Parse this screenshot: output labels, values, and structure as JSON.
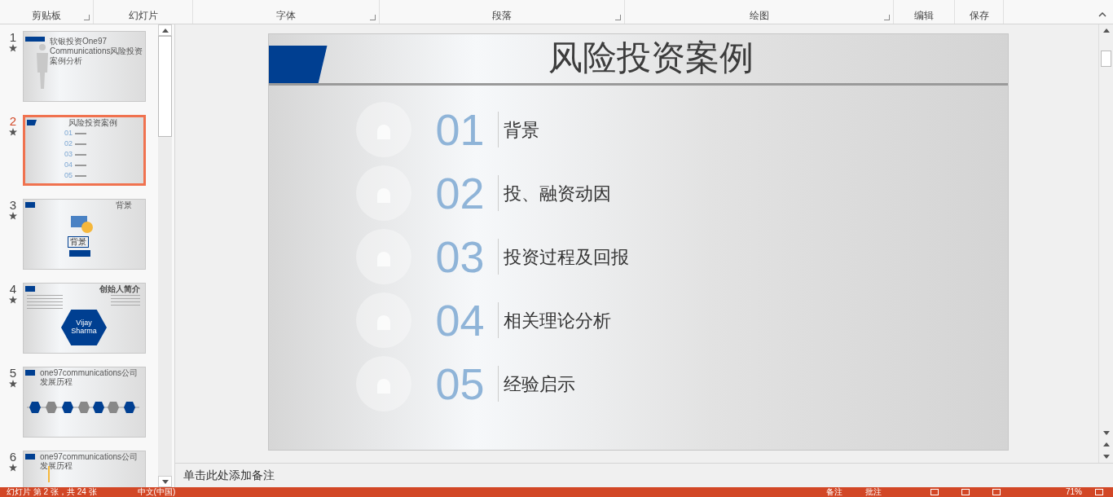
{
  "ribbon": {
    "groups": [
      {
        "label": "剪贴板",
        "launcher": true
      },
      {
        "label": "幻灯片",
        "launcher": false
      },
      {
        "label": "字体",
        "launcher": true
      },
      {
        "label": "段落",
        "launcher": true
      },
      {
        "label": "绘图",
        "launcher": true
      },
      {
        "label": "编辑",
        "launcher": false
      },
      {
        "label": "保存",
        "launcher": false
      }
    ]
  },
  "thumbnails": [
    {
      "number": "1",
      "selected": false,
      "kind": "cover",
      "title": "软银投资One97 Communications风险投资案例分析"
    },
    {
      "number": "2",
      "selected": true,
      "kind": "agenda",
      "title": "风险投资案例",
      "items": [
        "01",
        "02",
        "03",
        "04",
        "05"
      ]
    },
    {
      "number": "3",
      "selected": false,
      "kind": "section",
      "title": "背景",
      "caption": "背景"
    },
    {
      "number": "4",
      "selected": false,
      "kind": "profile",
      "title": "创始人简介",
      "caption": "Vijay Sharma"
    },
    {
      "number": "5",
      "selected": false,
      "kind": "timeline",
      "title": "one97communications公司发展历程"
    },
    {
      "number": "6",
      "selected": false,
      "kind": "list",
      "title": "one97communications公司发展历程"
    }
  ],
  "slide": {
    "title": "风险投资案例",
    "items": [
      {
        "number": "01",
        "label": "背景"
      },
      {
        "number": "02",
        "label": "投、融资动因"
      },
      {
        "number": "03",
        "label": "投资过程及回报"
      },
      {
        "number": "04",
        "label": "相关理论分析"
      },
      {
        "number": "05",
        "label": "经验启示"
      }
    ]
  },
  "notes": {
    "placeholder": "单击此处添加备注"
  },
  "status_bar": {
    "slide_info": "幻灯片 第 2 张，共 24 张",
    "language": "中文(中国)",
    "notes": "备注",
    "comments": "批注",
    "zoom": "71%"
  }
}
